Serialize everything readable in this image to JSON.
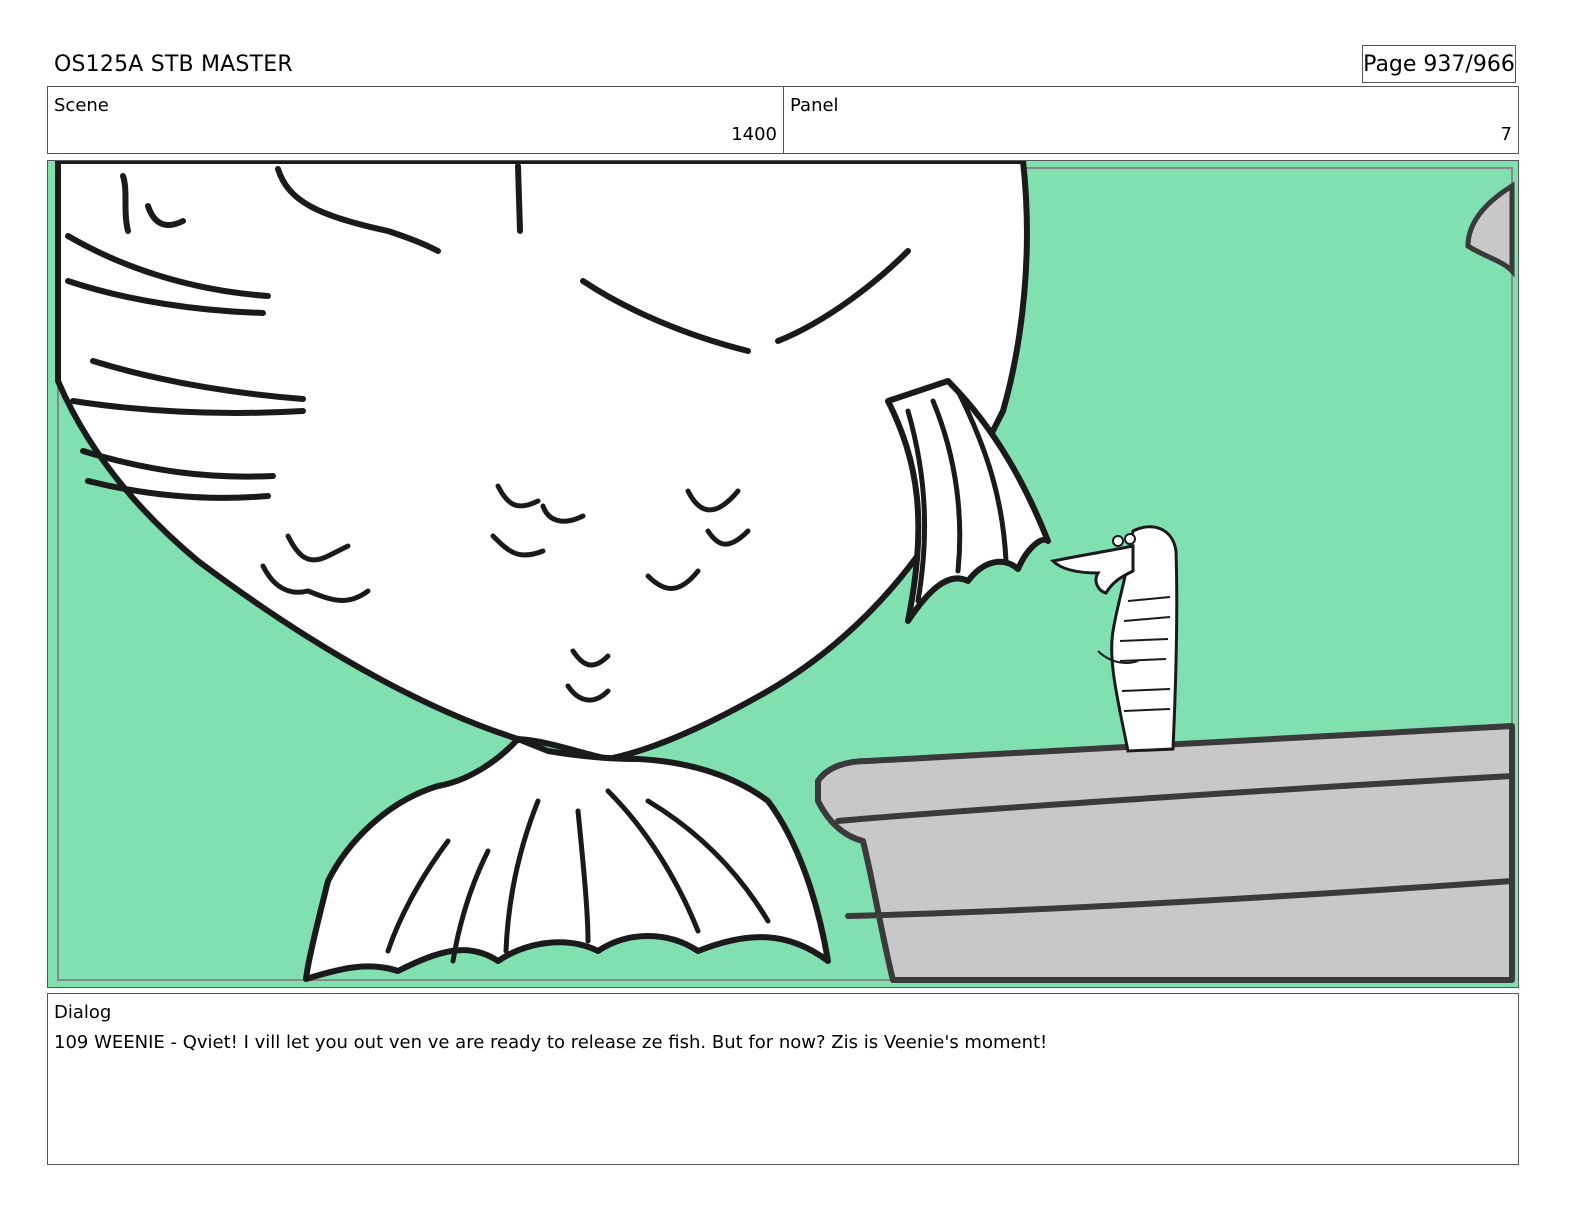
{
  "header": {
    "title": "OS125A STB MASTER",
    "page": "Page 937/966"
  },
  "scene": {
    "label": "Scene",
    "value": "1400"
  },
  "panel": {
    "label": "Panel",
    "value": "7"
  },
  "artwork": {
    "background_color": "#80e0b0",
    "platform_color": "#c8c8c8",
    "line_color": "#1a1a1a"
  },
  "dialog": {
    "label": "Dialog",
    "text": "109 WEENIE - Qviet! I vill let you out ven ve are ready to release ze fish. But for now? Zis is Veenie's moment!"
  }
}
